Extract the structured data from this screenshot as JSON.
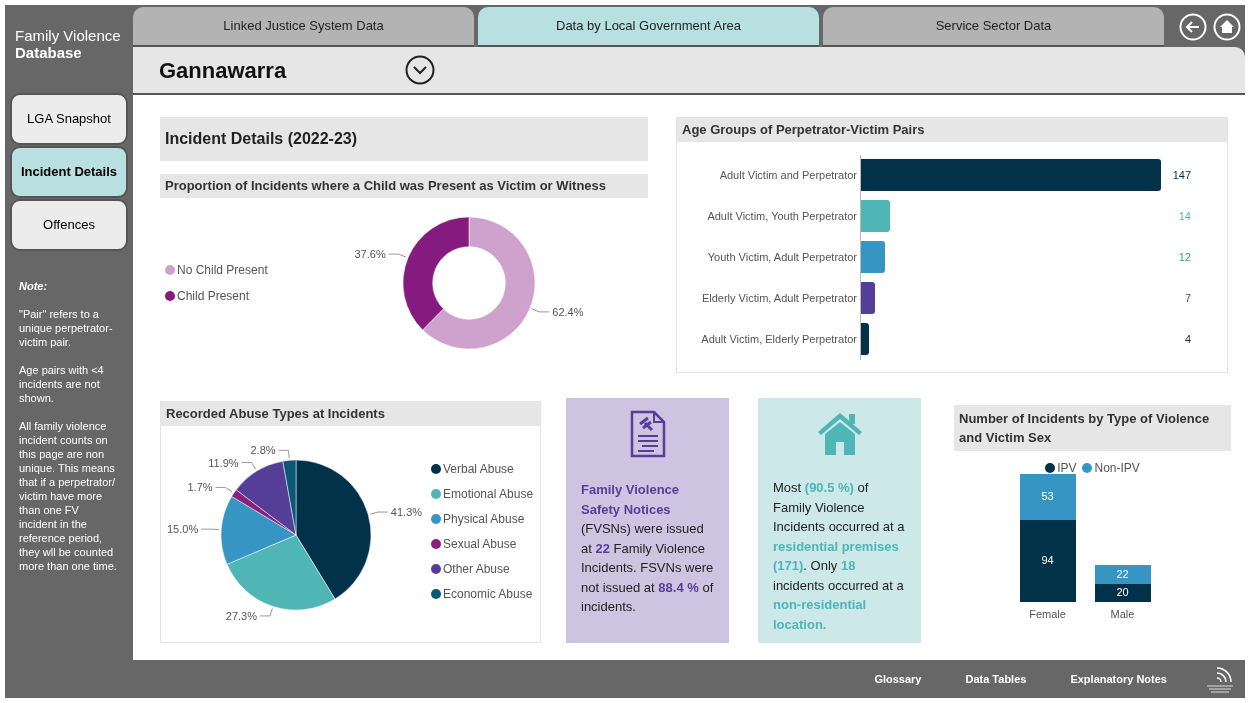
{
  "app_title": {
    "line_1": "Family Violence",
    "line_2": "Database"
  },
  "tabs": [
    {
      "label": "Linked Justice System Data",
      "selected": false
    },
    {
      "label": "Data by Local Government Area",
      "selected": true
    },
    {
      "label": "Service Sector Data",
      "selected": false
    }
  ],
  "sidebar": {
    "items": [
      {
        "label": "LGA Snapshot",
        "selected": false
      },
      {
        "label": "Incident Details",
        "selected": true
      },
      {
        "label": "Offences",
        "selected": false
      }
    ],
    "note_title": "Note:",
    "notes": [
      "\"Pair\" refers to a unique perpetrator- victim pair.",
      "Age pairs with <4 incidents are not shown.",
      "All family violence incident counts on this page are non unique. This means that if a perpetrator/ victim have more than one FV incident in the reference period, they wll be counted more than one time."
    ]
  },
  "lga_selector": {
    "value": "Gannawarra"
  },
  "page_title": "Incident Details (2022-23)",
  "child_present": {
    "title": "Proportion of Incidents where a Child was Present as Victim or Witness",
    "chart_data": {
      "type": "donut",
      "categories": [
        "No Child Present",
        "Child Present"
      ],
      "values": [
        62.4,
        37.6
      ],
      "colors": [
        "#cfa2ce",
        "#851b7f"
      ],
      "value_labels": [
        "62.4%",
        "37.6%"
      ]
    }
  },
  "age_groups": {
    "title": "Age Groups of Perpetrator-Victim Pairs",
    "chart_data": {
      "type": "bar",
      "orientation": "horizontal",
      "categories": [
        "Adult Victim and Perpetrator",
        "Adult Victim, Youth Perpetrator",
        "Youth Victim, Adult Perpetrator",
        "Elderly Victim, Adult Perpetrator",
        "Adult Victim, Elderly Perpetrator"
      ],
      "values": [
        147,
        14,
        12,
        7,
        4
      ],
      "colors": [
        "#02314a",
        "#50b5b5",
        "#3795c4",
        "#553e98",
        "#02314a"
      ],
      "value_labels": [
        "147",
        "14",
        "12",
        "7",
        "4"
      ]
    }
  },
  "abuse_types": {
    "title": "Recorded Abuse Types at Incidents",
    "chart_data": {
      "type": "pie",
      "categories": [
        "Verbal Abuse",
        "Emotional Abuse",
        "Physical Abuse",
        "Sexual Abuse",
        "Other Abuse",
        "Economic Abuse"
      ],
      "values": [
        41.3,
        27.3,
        15.0,
        1.7,
        11.9,
        2.8
      ],
      "colors": [
        "#02314a",
        "#50b5b5",
        "#3795c4",
        "#8a1f80",
        "#553e98",
        "#0b5876"
      ],
      "value_labels": [
        "41.3%",
        "27.3%",
        "15.0%",
        "1.7%",
        "11.9%",
        "2.8%"
      ]
    }
  },
  "cards": [
    {
      "kind": "notice",
      "text": "**Family Violence Safety Notices** (FVSNs) were issued at **22** Family Violence Incidents. FSVNs were not issued at **88.4 %** of incidents."
    },
    {
      "kind": "location",
      "text": "Most **(90.5 %)** of Family Violence Incidents occurred at a **residential premises (171)**. Only **18** incidents occurred at a **non-residential location.**"
    }
  ],
  "violence_by_sex": {
    "title": "Number of Incidents by Type of Violence and Victim Sex",
    "chart_data": {
      "type": "bar",
      "stacked": true,
      "categories": [
        "Female",
        "Male"
      ],
      "series": [
        {
          "name": "IPV",
          "color": "#02314a",
          "values": [
            94,
            20
          ]
        },
        {
          "name": "Non-IPV",
          "color": "#3795c4",
          "values": [
            53,
            22
          ]
        }
      ],
      "data_labels": true
    }
  },
  "footer_links": [
    "Glossary",
    "Data Tables",
    "Explanatory Notes"
  ]
}
